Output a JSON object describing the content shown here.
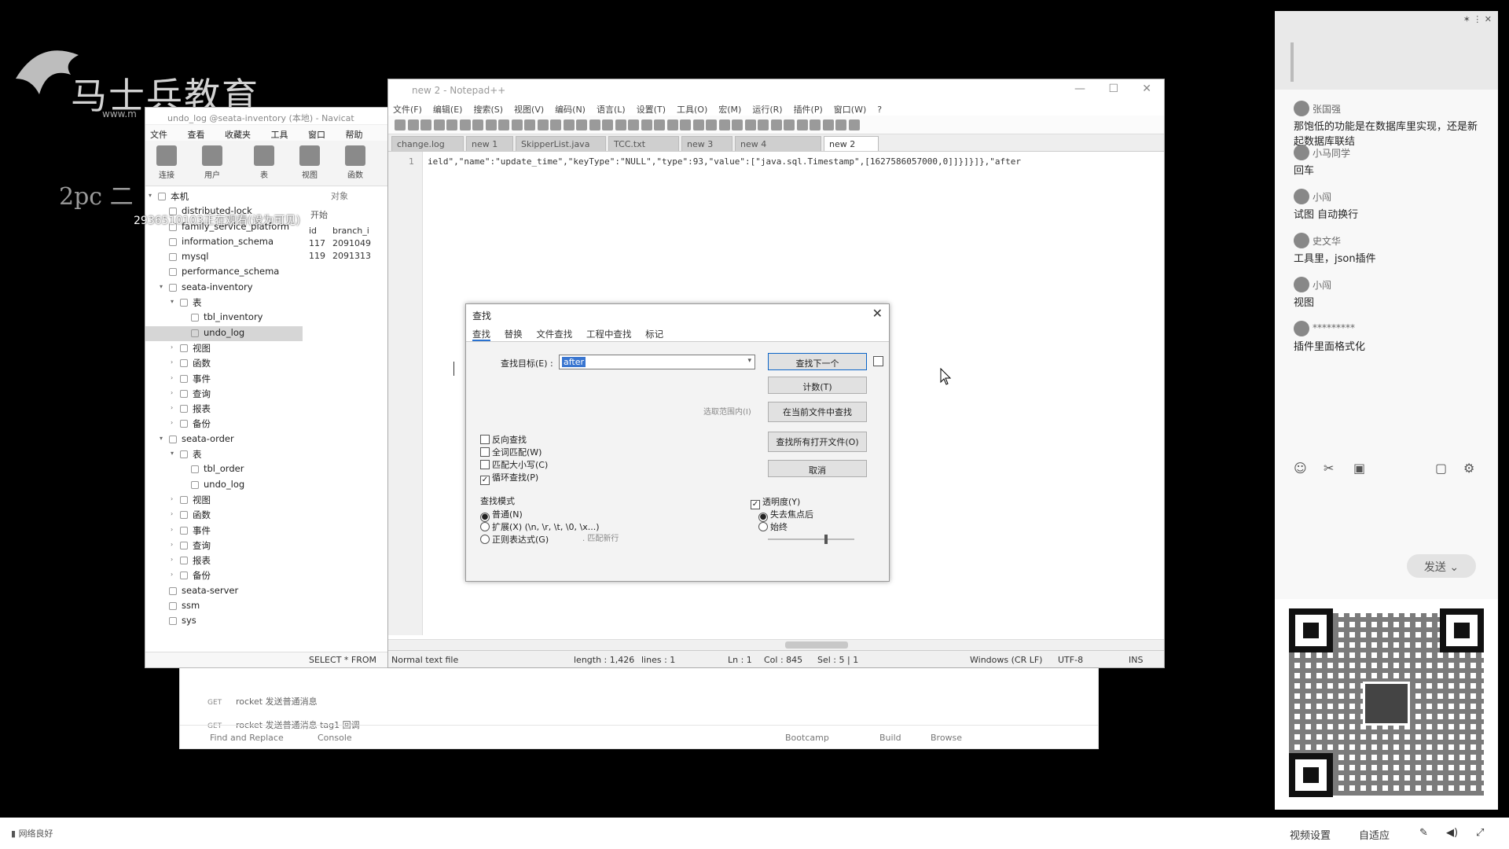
{
  "logo": {
    "brand": "马士兵教育",
    "url": "www.m"
  },
  "pc_label": "2pc 二",
  "overlay_text": "2936510103正在观看(设为可见)",
  "bottom_app": {
    "rows": [
      {
        "method": "GET",
        "label": "rocket 发送普通消息"
      },
      {
        "method": "GET",
        "label": "rocket 发送普通消息 tag1 回调"
      }
    ],
    "bar": [
      "Find and Replace",
      "Console",
      "Bootcamp",
      "Build",
      "Browse"
    ]
  },
  "navicat": {
    "title": "undo_log @seata-inventory (本地) - Navicat",
    "menu": [
      "文件",
      "查看",
      "收藏夹",
      "工具",
      "窗口",
      "帮助"
    ],
    "toolbar": [
      "连接",
      "用户",
      "表",
      "视图",
      "函数"
    ],
    "tree": [
      {
        "label": "本机",
        "indent": 0,
        "exp": "▾"
      },
      {
        "label": "distributed-lock",
        "indent": 1
      },
      {
        "label": "family_service_platform",
        "indent": 1
      },
      {
        "label": "information_schema",
        "indent": 1
      },
      {
        "label": "mysql",
        "indent": 1
      },
      {
        "label": "performance_schema",
        "indent": 1
      },
      {
        "label": "seata-inventory",
        "indent": 1,
        "exp": "▾"
      },
      {
        "label": "表",
        "indent": 2,
        "exp": "▾"
      },
      {
        "label": "tbl_inventory",
        "indent": 3
      },
      {
        "label": "undo_log",
        "indent": 3,
        "selected": true
      },
      {
        "label": "视图",
        "indent": 2,
        "exp": "›"
      },
      {
        "label": "函数",
        "indent": 2,
        "exp": "›"
      },
      {
        "label": "事件",
        "indent": 2,
        "exp": "›"
      },
      {
        "label": "查询",
        "indent": 2,
        "exp": "›"
      },
      {
        "label": "报表",
        "indent": 2,
        "exp": "›"
      },
      {
        "label": "备份",
        "indent": 2,
        "exp": "›"
      },
      {
        "label": "seata-order",
        "indent": 1,
        "exp": "▾"
      },
      {
        "label": "表",
        "indent": 2,
        "exp": "▾"
      },
      {
        "label": "tbl_order",
        "indent": 3
      },
      {
        "label": "undo_log",
        "indent": 3
      },
      {
        "label": "视图",
        "indent": 2,
        "exp": "›"
      },
      {
        "label": "函数",
        "indent": 2,
        "exp": "›"
      },
      {
        "label": "事件",
        "indent": 2,
        "exp": "›"
      },
      {
        "label": "查询",
        "indent": 2,
        "exp": "›"
      },
      {
        "label": "报表",
        "indent": 2,
        "exp": "›"
      },
      {
        "label": "备份",
        "indent": 2,
        "exp": "›"
      },
      {
        "label": "seata-server",
        "indent": 1
      },
      {
        "label": "ssm",
        "indent": 1
      },
      {
        "label": "sys",
        "indent": 1
      }
    ],
    "right": {
      "obj": "对象",
      "open": "开始",
      "cols": [
        "id",
        "branch_i"
      ],
      "rows": [
        [
          "117",
          "2091049"
        ],
        [
          "119",
          "2091313"
        ]
      ]
    },
    "status": "SELECT * FROM"
  },
  "notepad": {
    "title": "new 2 - Notepad++",
    "menu": [
      "文件(F)",
      "编辑(E)",
      "搜索(S)",
      "视图(V)",
      "编码(N)",
      "语言(L)",
      "设置(T)",
      "工具(O)",
      "宏(M)",
      "运行(R)",
      "插件(P)",
      "窗口(W)",
      "?"
    ],
    "tabs": [
      "change.log",
      "new 1",
      "SkipperList.java",
      "TCC.txt",
      "new 3",
      "new 4",
      "new 2"
    ],
    "line_no": "1",
    "code": "ield\",\"name\":\"update_time\",\"keyType\":\"NULL\",\"type\":93,\"value\":[\"java.sql.Timestamp\",[1627586057000,0]]}]}]},\"after",
    "status": {
      "type": "Normal text file",
      "length": "length : 1,426",
      "lines": "lines : 1",
      "ln": "Ln : 1",
      "col": "Col : 845",
      "sel": "Sel : 5 | 1",
      "eol": "Windows (CR LF)",
      "enc": "UTF-8",
      "ins": "INS"
    }
  },
  "find": {
    "title": "查找",
    "tabs": [
      "查找",
      "替换",
      "文件查找",
      "工程中查找",
      "标记"
    ],
    "target_label": "查找目标(E) :",
    "target_value": "after",
    "buttons": [
      "查找下一个",
      "计数(T)",
      "在当前文件中查找",
      "查找所有打开文件(O)",
      "取消"
    ],
    "in_selection": "选取范围内(I)",
    "options": [
      {
        "label": "反向查找",
        "checked": false
      },
      {
        "label": "全词匹配(W)",
        "checked": false
      },
      {
        "label": "匹配大小写(C)",
        "checked": false
      },
      {
        "label": "循环查找(P)",
        "checked": true
      }
    ],
    "mode_label": "查找模式",
    "modes": [
      {
        "label": "普通(N)",
        "checked": true
      },
      {
        "label": "扩展(X) (\\n, \\r, \\t, \\0, \\x...)",
        "checked": false
      },
      {
        "label": "正则表达式(G)",
        "checked": false
      }
    ],
    "dotall": ". 匹配新行",
    "transparency": "透明度(Y)",
    "trans_modes": [
      {
        "label": "失去焦点后",
        "checked": true
      },
      {
        "label": "始终",
        "checked": false
      }
    ]
  },
  "chat": {
    "messages": [
      {
        "user": "张国强",
        "text": "那饱低的功能是在数据库里实现，还是新起数据库联结"
      },
      {
        "user": "小马同学",
        "text": "回车"
      },
      {
        "user": "小闯",
        "text": "试图 自动换行"
      },
      {
        "user": "史文华",
        "text": "工具里，json插件"
      },
      {
        "user": "小闯",
        "text": "视图"
      },
      {
        "user": "*********",
        "text": "插件里面格式化"
      }
    ],
    "send": "发送"
  },
  "taskbar": {
    "network": "网络良好",
    "video": "视频设置",
    "adaptive": "自适应"
  }
}
